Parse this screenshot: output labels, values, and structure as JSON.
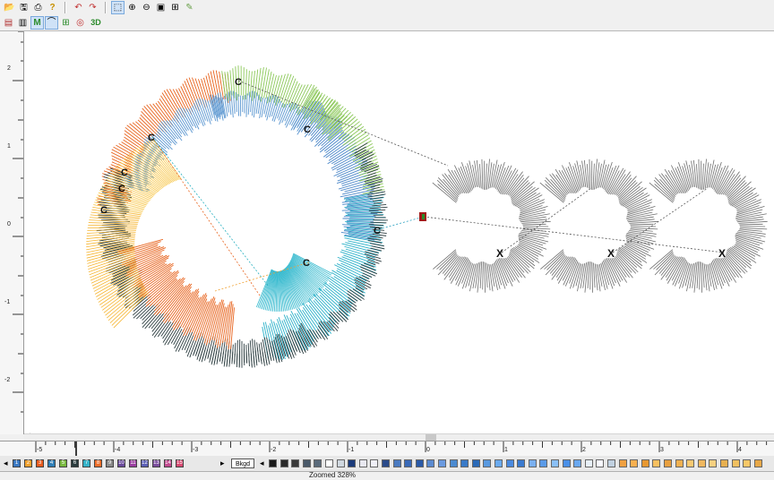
{
  "toolbar1": {
    "open_icon": "📂",
    "save_icon": "🖫",
    "print_icon": "⎙",
    "help_icon": "?",
    "undo_icon": "↶",
    "redo_icon": "↷",
    "select_icon": "⬚",
    "zoom_in_icon": "⊕",
    "zoom_out_icon": "⊖",
    "zoom_fit_icon": "▣",
    "zoom_box_icon": "⊞",
    "pencil_icon": "✎"
  },
  "toolbar2": {
    "design_icon": "▤",
    "realistic_icon": "▥",
    "stitches_icon": "M",
    "outline_icon": "⌒",
    "grid_icon": "⊞",
    "hoop_icon": "◎",
    "view3d_label": "3D"
  },
  "rulers": {
    "vertical": [
      "2",
      "1",
      "0",
      "-1",
      "-2"
    ],
    "horizontal": [
      "-5",
      "-4",
      "-3",
      "-2",
      "-1",
      "0",
      "1",
      "2",
      "3",
      "4"
    ]
  },
  "canvas": {
    "markers": {
      "c": "C",
      "x": "X"
    },
    "scroll_left": "<"
  },
  "palette": {
    "left_arrow": "◂",
    "right_arrow": "▸",
    "threads": [
      {
        "label": "1",
        "color": "#3a78c2"
      },
      {
        "label": "2",
        "color": "#f2a12e"
      },
      {
        "label": "3",
        "color": "#e85b1e"
      },
      {
        "label": "4",
        "color": "#2f7fb8"
      },
      {
        "label": "5",
        "color": "#78b83e"
      },
      {
        "label": "6",
        "color": "#2a3b3d"
      },
      {
        "label": "7",
        "color": "#35b2c8"
      },
      {
        "label": "8",
        "color": "#ee6e2a"
      },
      {
        "label": "9",
        "color": "#8a8a8a"
      },
      {
        "label": "10",
        "color": "#6a4a9c"
      },
      {
        "label": "11",
        "color": "#9a3ea0"
      },
      {
        "label": "12",
        "color": "#5b5fb5"
      },
      {
        "label": "13",
        "color": "#7a4d9d"
      },
      {
        "label": "14",
        "color": "#c14a8f"
      },
      {
        "label": "15",
        "color": "#d84a72"
      }
    ],
    "bkgd_label": "Bkgd",
    "colors": [
      "#1a1a1a",
      "#2a2a2a",
      "#3a3a3a",
      "#4a5a6a",
      "#5a6a7a",
      "#ffffff",
      "#d0d8e0",
      "#1a3a7a",
      "#e8e8f0",
      "#f0f0f8",
      "#2a4a8a",
      "#4a7ac0",
      "#3a6ab8",
      "#2a5aa8",
      "#5a8ad0",
      "#6a9ae0",
      "#4a8ad0",
      "#3a7ac8",
      "#2a6ab8",
      "#5a9ae0",
      "#6aaaf0",
      "#4a8ae0",
      "#3a7ad0",
      "#7ab0f0",
      "#5a9ae8",
      "#8ac0f8",
      "#4a90e8",
      "#6aa8f0",
      "#e8f0f8",
      "#f8f8ff",
      "#c0d0e0",
      "#f0a040",
      "#f8b050",
      "#e89830",
      "#f8c060",
      "#e8a040",
      "#f0b050",
      "#f8c870",
      "#f0b860",
      "#f8d080",
      "#e8b050",
      "#f0c060",
      "#f8c868",
      "#e8a848"
    ]
  },
  "status": {
    "text": "Zoomed 328%"
  }
}
